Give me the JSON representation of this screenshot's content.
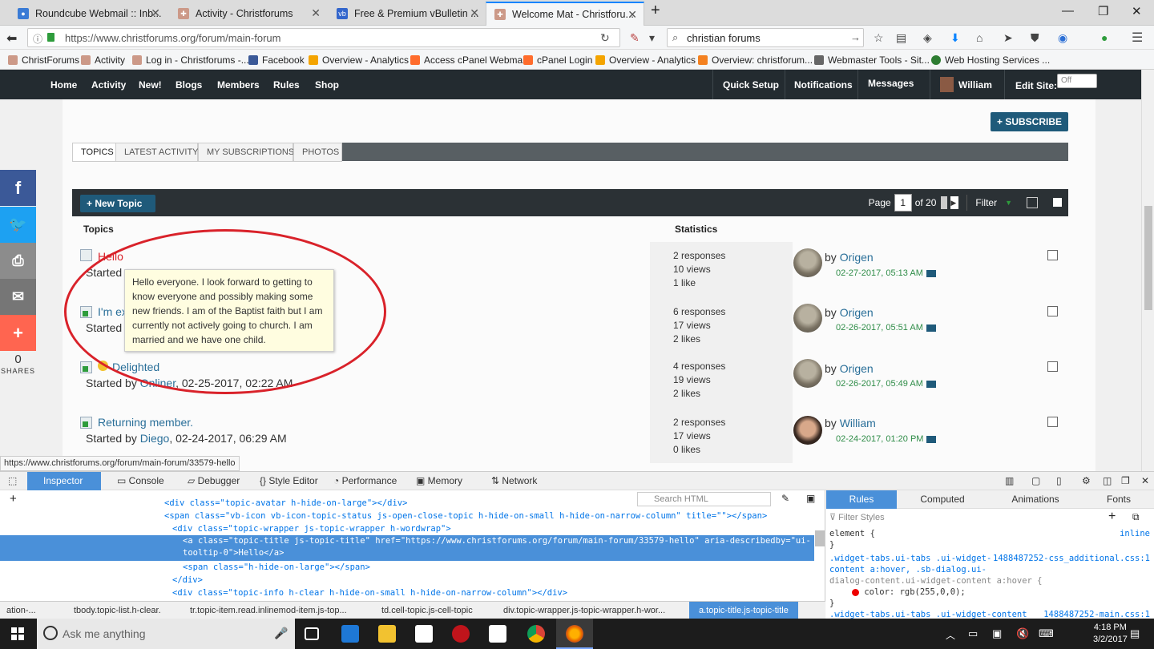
{
  "browser": {
    "tabs": [
      {
        "title": "Roundcube Webmail :: Inb..."
      },
      {
        "title": "Activity - Christforums"
      },
      {
        "title": "Free & Premium vBulletin ..."
      },
      {
        "title": "Welcome Mat - Christforu..."
      }
    ],
    "new_tab": "+",
    "url": "https://www.christforums.org/forum/main-forum",
    "search_value": "christian forums",
    "bookmarks": [
      "ChristForums",
      "Activity",
      "Log in - Christforums -...",
      "Facebook",
      "Overview - Analytics",
      "Access cPanel Webmail",
      "cPanel Login",
      "Overview - Analytics",
      "Overview: christforum...",
      "Webmaster Tools - Sit...",
      "Web Hosting Services ..."
    ]
  },
  "site": {
    "nav": [
      "Home",
      "Activity",
      "New!",
      "Blogs",
      "Members",
      "Rules",
      "Shop"
    ],
    "right": {
      "quick_setup": "Quick Setup",
      "notifications": "Notifications",
      "messages": "Messages",
      "user": "William",
      "edit_site": "Edit Site:",
      "toggle": "Off"
    }
  },
  "forum": {
    "subscribe": "+ SUBSCRIBE",
    "tabs": [
      "TOPICS",
      "LATEST ACTIVITY",
      "MY SUBSCRIPTIONS",
      "PHOTOS"
    ],
    "new_topic": "+ New Topic",
    "pager": {
      "label": "Page",
      "current": "1",
      "of": "of 20",
      "filter": "Filter"
    },
    "col_topics": "Topics",
    "col_stats": "Statistics",
    "rows": [
      {
        "title": "Hello",
        "started_prefix": "Started",
        "author": "",
        "date": "",
        "responses": "2 responses",
        "views": "10 views",
        "likes": "1 like",
        "last_by": "by",
        "last_user": "Origen",
        "last_date": "02-27-2017, 05:13 AM"
      },
      {
        "title": "I'm ex",
        "started_prefix": "Started",
        "author": "",
        "date": "",
        "responses": "6 responses",
        "views": "17 views",
        "likes": "2 likes",
        "last_by": "by",
        "last_user": "Origen",
        "last_date": "02-26-2017, 05:51 AM"
      },
      {
        "title": "Delighted",
        "started_prefix": "Started by",
        "author": "Onliner",
        "date": ", 02-25-2017, 02:22 AM",
        "responses": "4 responses",
        "views": "19 views",
        "likes": "2 likes",
        "last_by": "by",
        "last_user": "Origen",
        "last_date": "02-26-2017, 05:49 AM"
      },
      {
        "title": "Returning member.",
        "started_prefix": "Started by",
        "author": "Diego",
        "date": ", 02-24-2017, 06:29 AM",
        "responses": "2 responses",
        "views": "17 views",
        "likes": "0 likes",
        "last_by": "by",
        "last_user": "William",
        "last_date": "02-24-2017, 01:20 PM"
      }
    ],
    "tooltip": "Hello everyone. I look forward to getting to know everyone and possibly making some new friends. I am of the Baptist faith but I am currently not actively going to church. I am married and we have one child."
  },
  "share": {
    "count": "0",
    "label": "SHARES"
  },
  "status_url": "https://www.christforums.org/forum/main-forum/33579-hello",
  "devtools": {
    "tabs": [
      "Inspector",
      "Console",
      "Debugger",
      "Style Editor",
      "Performance",
      "Memory",
      "Network"
    ],
    "search_placeholder": "Search HTML",
    "html_lines": [
      "<div class=\"topic-avatar h-hide-on-large\"></div>",
      "<span class=\"vb-icon vb-icon-topic-status js-open-close-topic h-hide-on-small h-hide-on-narrow-column\" title=\"\"></span>",
      "<div class=\"topic-wrapper js-topic-wrapper h-wordwrap\">",
      "<a class=\"topic-title js-topic-title\" href=\"https://www.christforums.org/forum/main-forum/33579-hello\" aria-describedby=\"ui-",
      "tooltip-0\">Hello</a>",
      "<span class=\"h-hide-on-large\"></span>",
      "</div>",
      "<div class=\"topic-info h-clear h-hide-on-small h-hide-on-narrow-column\"></div>"
    ],
    "breadcrumbs": [
      "ation-...",
      "tbody.topic-list.h-clear.",
      "tr.topic-item.read.inlinemod-item.js-top...",
      "td.cell-topic.js-cell-topic",
      "div.topic-wrapper.js-topic-wrapper.h-wor...",
      "a.topic-title.js-topic-title"
    ],
    "rules_tabs": [
      "Rules",
      "Computed",
      "Animations",
      "Fonts"
    ],
    "filter_placeholder": "Filter Styles",
    "rules": {
      "element": "element {",
      "element_src": "inline",
      "close": "}",
      "sel1": ".widget-tabs.ui-tabs .ui-widget-",
      "sel1_src": "1488487252-css_additional.css:1",
      "sel2": "content a:hover, .sb-dialog.ui-",
      "sel3": "dialog-content.ui-widget-content a:hover {",
      "prop": "color: rgb(255,0,0);",
      "sel4": ".widget-tabs.ui-tabs .ui-widget-content",
      "sel4_src": "1488487252-main.css:1"
    }
  },
  "taskbar": {
    "search": "Ask me anything",
    "time": "4:18 PM",
    "date": "3/2/2017"
  }
}
